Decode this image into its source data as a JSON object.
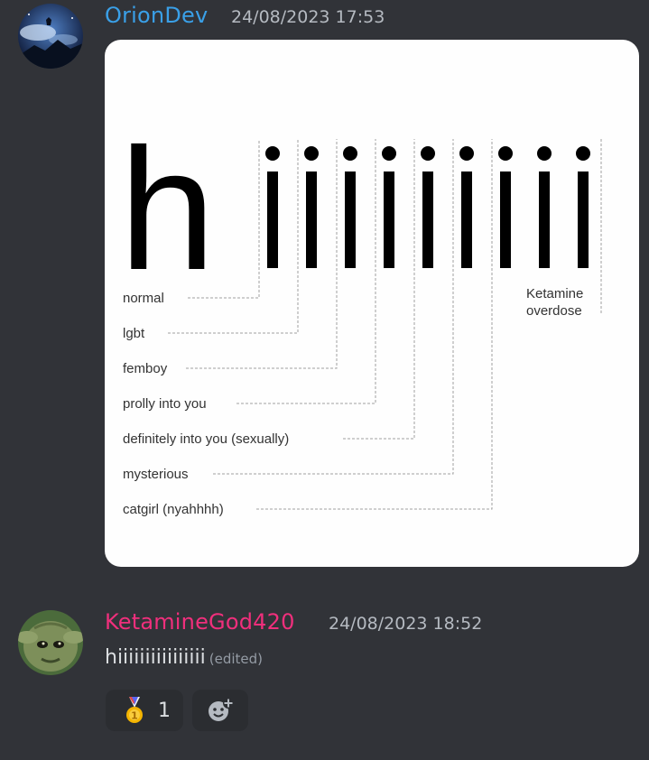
{
  "messages": [
    {
      "author": "OrionDev",
      "timestamp": "24/08/2023 17:53",
      "author_color": "#3aa0e8",
      "attachment": {
        "type": "image",
        "big_text": "hiiiiiiiiii",
        "labels": [
          "normal",
          "lgbt",
          "femboy",
          "prolly into you",
          "definitely into you (sexually)",
          "mysterious",
          "catgirl (nyahhhh)"
        ],
        "right_label": [
          "Ketamine",
          "overdose"
        ]
      }
    },
    {
      "author": "KetamineGod420",
      "timestamp": "24/08/2023 18:52",
      "author_color": "#f02f7c",
      "text": "hiiiiiiiiiiiiiiii",
      "edited_label": "(edited)",
      "reactions": [
        {
          "emoji": "medal-icon",
          "count": "1"
        },
        {
          "emoji": "add-reaction-icon"
        }
      ]
    }
  ]
}
